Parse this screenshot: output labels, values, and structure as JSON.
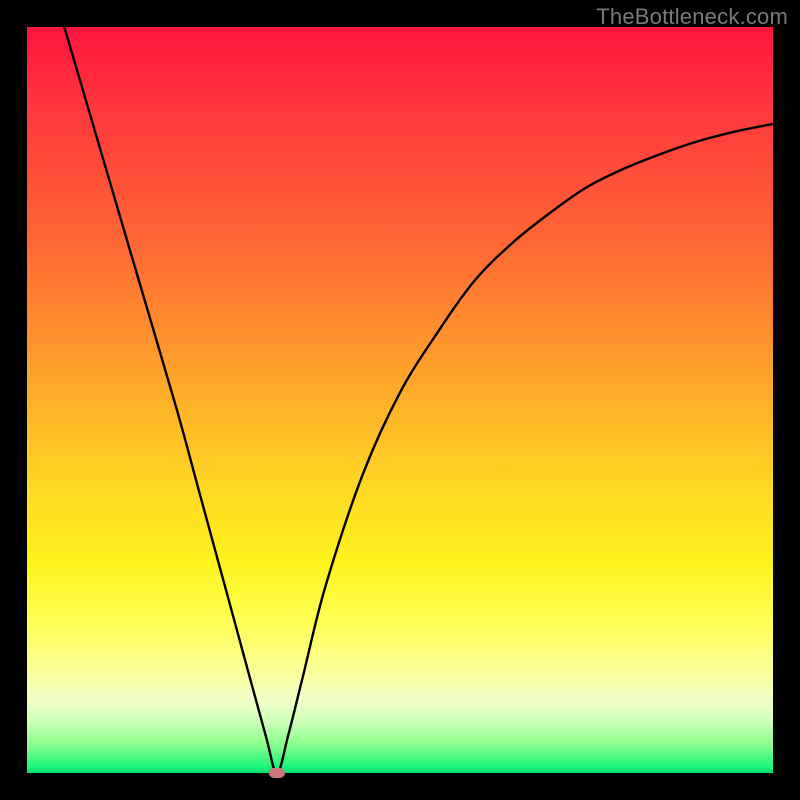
{
  "watermark": "TheBottleneck.com",
  "chart_data": {
    "type": "line",
    "title": "",
    "xlabel": "",
    "ylabel": "",
    "x_range": [
      0,
      1
    ],
    "y_range": [
      0,
      1
    ],
    "background_gradient": {
      "top_color": "#ff143e",
      "bottom_color": "#00e472",
      "description": "vertical gradient red→orange→yellow→green representing bottleneck severity (high at top, low at bottom)"
    },
    "series": [
      {
        "name": "bottleneck-curve",
        "x": [
          0.05,
          0.1,
          0.15,
          0.2,
          0.23,
          0.26,
          0.29,
          0.32,
          0.335,
          0.35,
          0.37,
          0.4,
          0.45,
          0.5,
          0.55,
          0.6,
          0.65,
          0.7,
          0.75,
          0.8,
          0.85,
          0.9,
          0.95,
          1.0
        ],
        "y": [
          1.0,
          0.83,
          0.66,
          0.49,
          0.38,
          0.27,
          0.16,
          0.05,
          0.0,
          0.05,
          0.13,
          0.25,
          0.4,
          0.51,
          0.59,
          0.66,
          0.71,
          0.75,
          0.785,
          0.81,
          0.83,
          0.847,
          0.86,
          0.87
        ]
      }
    ],
    "marker": {
      "name": "optimal-point",
      "x": 0.335,
      "y": 0.0,
      "color": "#c97a78"
    }
  }
}
